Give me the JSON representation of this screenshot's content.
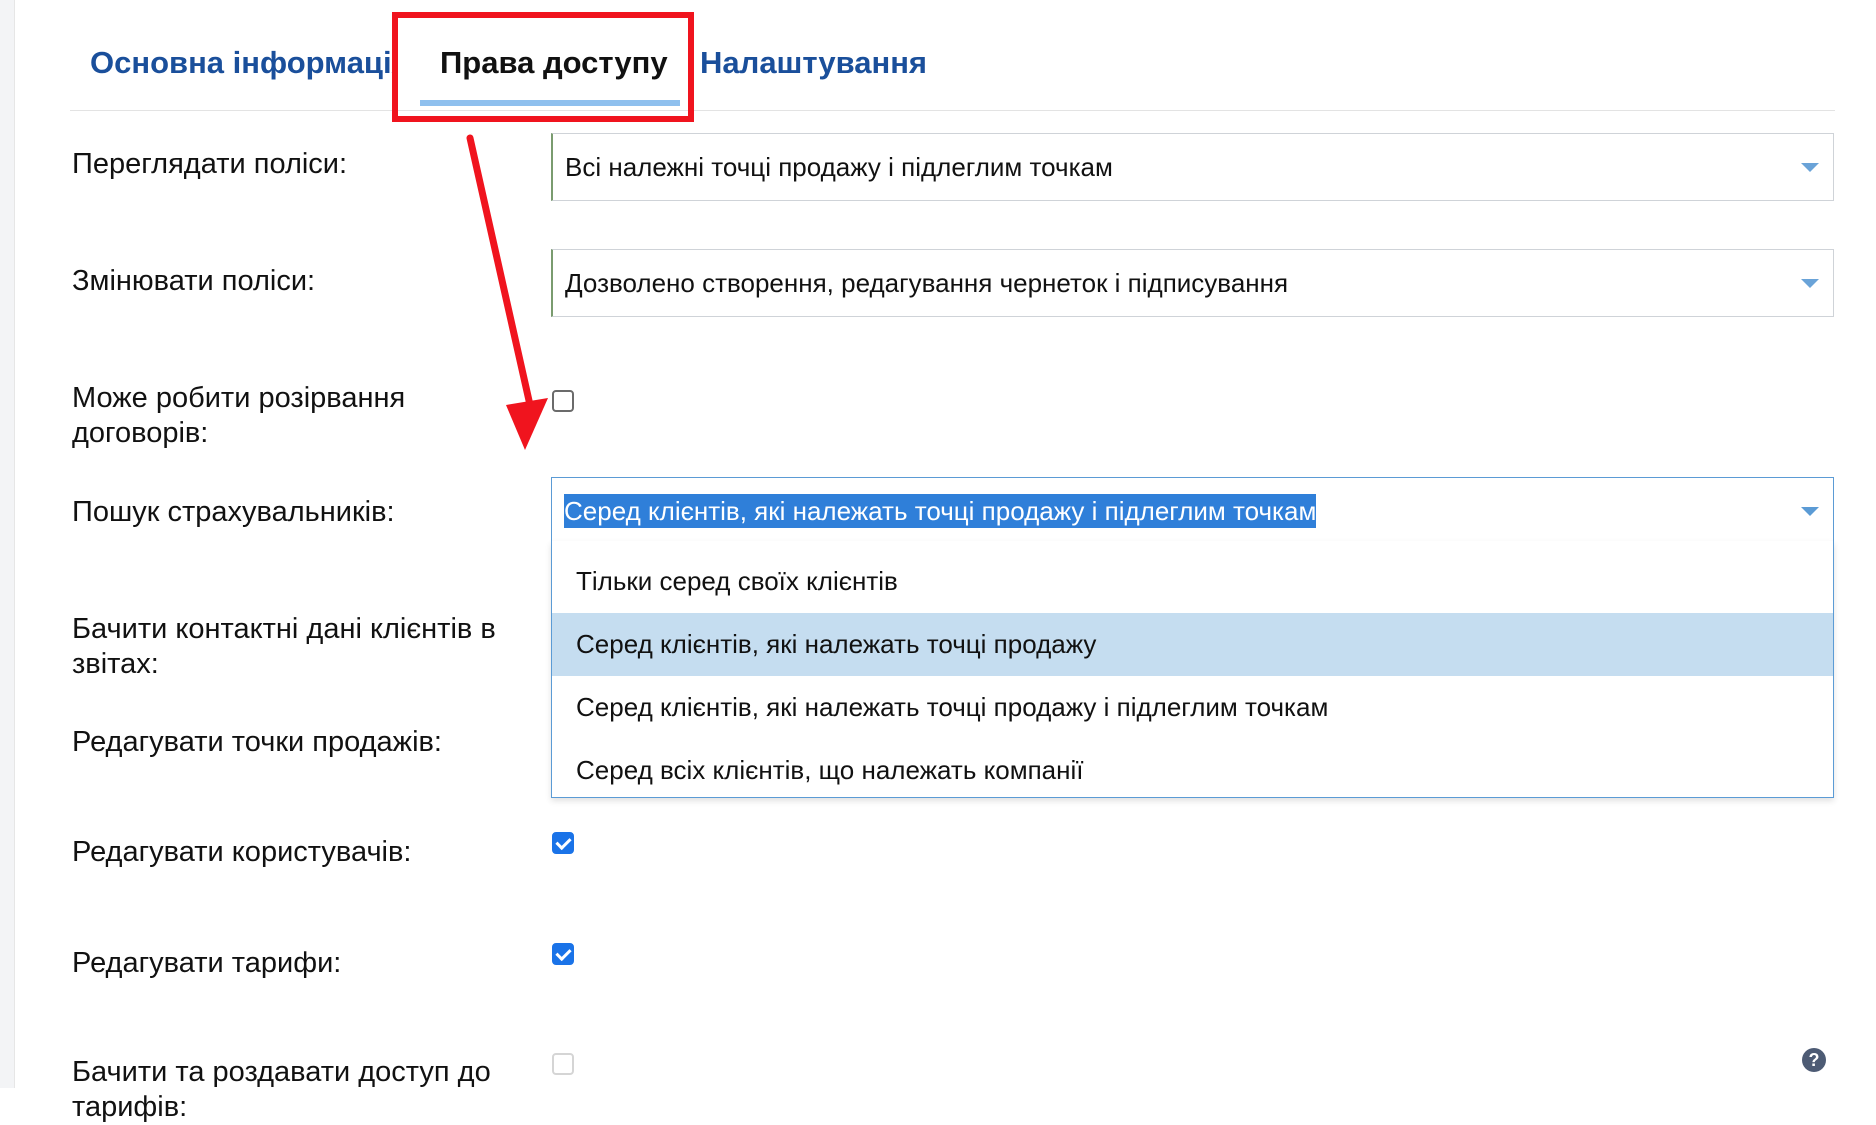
{
  "tabs": [
    {
      "label": "Основна інформація"
    },
    {
      "label": "Права доступу"
    },
    {
      "label": "Налаштування"
    }
  ],
  "form": {
    "view_policies": {
      "label": "Переглядати поліси:",
      "value": "Всі належні точці продажу і підлеглим точкам"
    },
    "edit_policies": {
      "label": "Змінювати поліси:",
      "value": "Дозволено створення, редагування чернеток і підписування"
    },
    "terminate": {
      "label_line1": "Може робити розірвання",
      "label_line2": "договорів:",
      "checked": false
    },
    "search_insurers": {
      "label": "Пошук страхувальників:",
      "value": "Серед клієнтів, які належать точці продажу і підлеглим точкам",
      "options": [
        "Тільки серед своїх клієнтів",
        "Серед клієнтів, які належать точці продажу",
        "Серед клієнтів, які належать точці продажу і підлеглим точкам",
        "Серед всіх клієнтів, що належать компанії"
      ],
      "hovered_option": 1
    },
    "see_contacts": {
      "label_line1": "Бачити контактні дані клієнтів в",
      "label_line2": "звітах:"
    },
    "edit_points": {
      "label": "Редагувати точки продажів:"
    },
    "edit_users": {
      "label": "Редагувати користувачів:",
      "checked": true
    },
    "edit_tariffs": {
      "label": "Редагувати тарифи:",
      "checked": true
    },
    "share_tariffs": {
      "label_line1": "Бачити та роздавати доступ до",
      "label_line2": "тарифів:",
      "checked": false,
      "disabled": true
    }
  },
  "help_icon": "question-circle-icon",
  "colors": {
    "accent": "#1a4f9b",
    "annotation": "#f0141e",
    "selection": "#2f7fd9",
    "hover": "#c5ddf0"
  }
}
